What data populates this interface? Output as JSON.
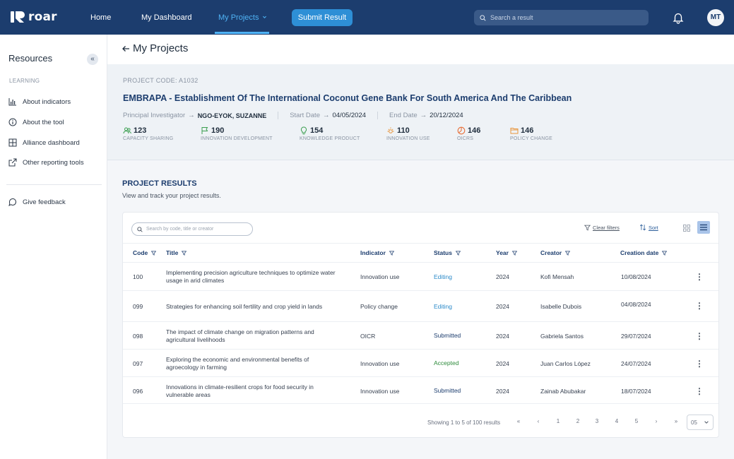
{
  "app": {
    "logo_text": "roar"
  },
  "nav": {
    "home": "Home",
    "dashboard": "My Dashboard",
    "projects": "My Projects",
    "submit": "Submit Result",
    "search_placeholder": "Search a result",
    "avatar_initials": "MT"
  },
  "sidebar": {
    "title": "Resources",
    "section": "LEARNING",
    "items": [
      {
        "label": "About indicators",
        "icon": "bar-chart-icon"
      },
      {
        "label": "About the tool",
        "icon": "info-icon"
      },
      {
        "label": "Alliance dashboard",
        "icon": "layout-icon"
      },
      {
        "label": "Other reporting tools",
        "icon": "external-link-icon"
      }
    ],
    "feedback": "Give feedback"
  },
  "page": {
    "title": "My Projects"
  },
  "project": {
    "code": "PROJECT CODE: A1032",
    "title": "EMBRAPA - Establishment Of The International Coconut Gene Bank For South America And The Caribbean",
    "pi_label": "Principal Investigator",
    "pi_value": "NGO-EYOK, SUZANNE",
    "start_label": "Start Date",
    "start_value": "04/05/2024",
    "end_label": "End Date",
    "end_value": "20/12/2024",
    "stats": [
      {
        "value": "123",
        "label": "CAPACITY SHARING",
        "icon": "people-icon",
        "color": "#3a9e4f"
      },
      {
        "value": "190",
        "label": "INNOVATION DEVELOPMENT",
        "icon": "flag-icon",
        "color": "#3a9e4f"
      },
      {
        "value": "154",
        "label": "KNOWLEDGE PRODUCT",
        "icon": "lightbulb-icon",
        "color": "#3a9e4f"
      },
      {
        "value": "110",
        "label": "INNOVATION USE",
        "icon": "sun-icon",
        "color": "#e8943a"
      },
      {
        "value": "146",
        "label": "OICRS",
        "icon": "pie-icon",
        "color": "#e8703a"
      },
      {
        "value": "146",
        "label": "POLICY CHANGE",
        "icon": "folder-icon",
        "color": "#e8943a"
      }
    ]
  },
  "results": {
    "title": "PROJECT RESULTS",
    "subtitle": "View and track your project results.",
    "search_placeholder": "Search by code, title or creator",
    "clear_filters": "Clear filters",
    "sort": "Sort",
    "columns": [
      "Code",
      "Title",
      "Indicator",
      "Status",
      "Year",
      "Creator",
      "Creation date"
    ],
    "rows": [
      {
        "code": "100",
        "title": "Implementing precision agriculture techniques to optimize water usage in arid climates",
        "indicator": "Innovation use",
        "status": "Editing",
        "year": "2024",
        "creator": "Kofi Mensah",
        "date": "10/08/2024"
      },
      {
        "code": "099",
        "title": "Strategies for enhancing soil fertility and crop yield in lands",
        "indicator": "Policy change",
        "status": "Editing",
        "year": "2024",
        "creator": "Isabelle Dubois",
        "date": "04/08/2024"
      },
      {
        "code": "098",
        "title": "The impact of climate change on migration patterns and agricultural livelihoods",
        "indicator": "OICR",
        "status": "Submitted",
        "year": "2024",
        "creator": "Gabriela Santos",
        "date": "29/07/2024"
      },
      {
        "code": "097",
        "title": "Exploring the economic and environmental benefits of agroecology in farming",
        "indicator": "Innovation use",
        "status": "Accepted",
        "year": "2024",
        "creator": "Juan Carlos López",
        "date": "24/07/2024"
      },
      {
        "code": "096",
        "title": "Innovations in climate-resilient crops for food security in vulnerable areas",
        "indicator": "Innovation use",
        "status": "Submitted",
        "year": "2024",
        "creator": "Zainab Abubakar",
        "date": "18/07/2024"
      }
    ],
    "pagination": {
      "info": "Showing 1 to 5 of 100 results",
      "first": "«",
      "prev": "‹",
      "pages": [
        "1",
        "2",
        "3",
        "4",
        "5"
      ],
      "next": "›",
      "last": "»",
      "per_page": "05"
    }
  }
}
